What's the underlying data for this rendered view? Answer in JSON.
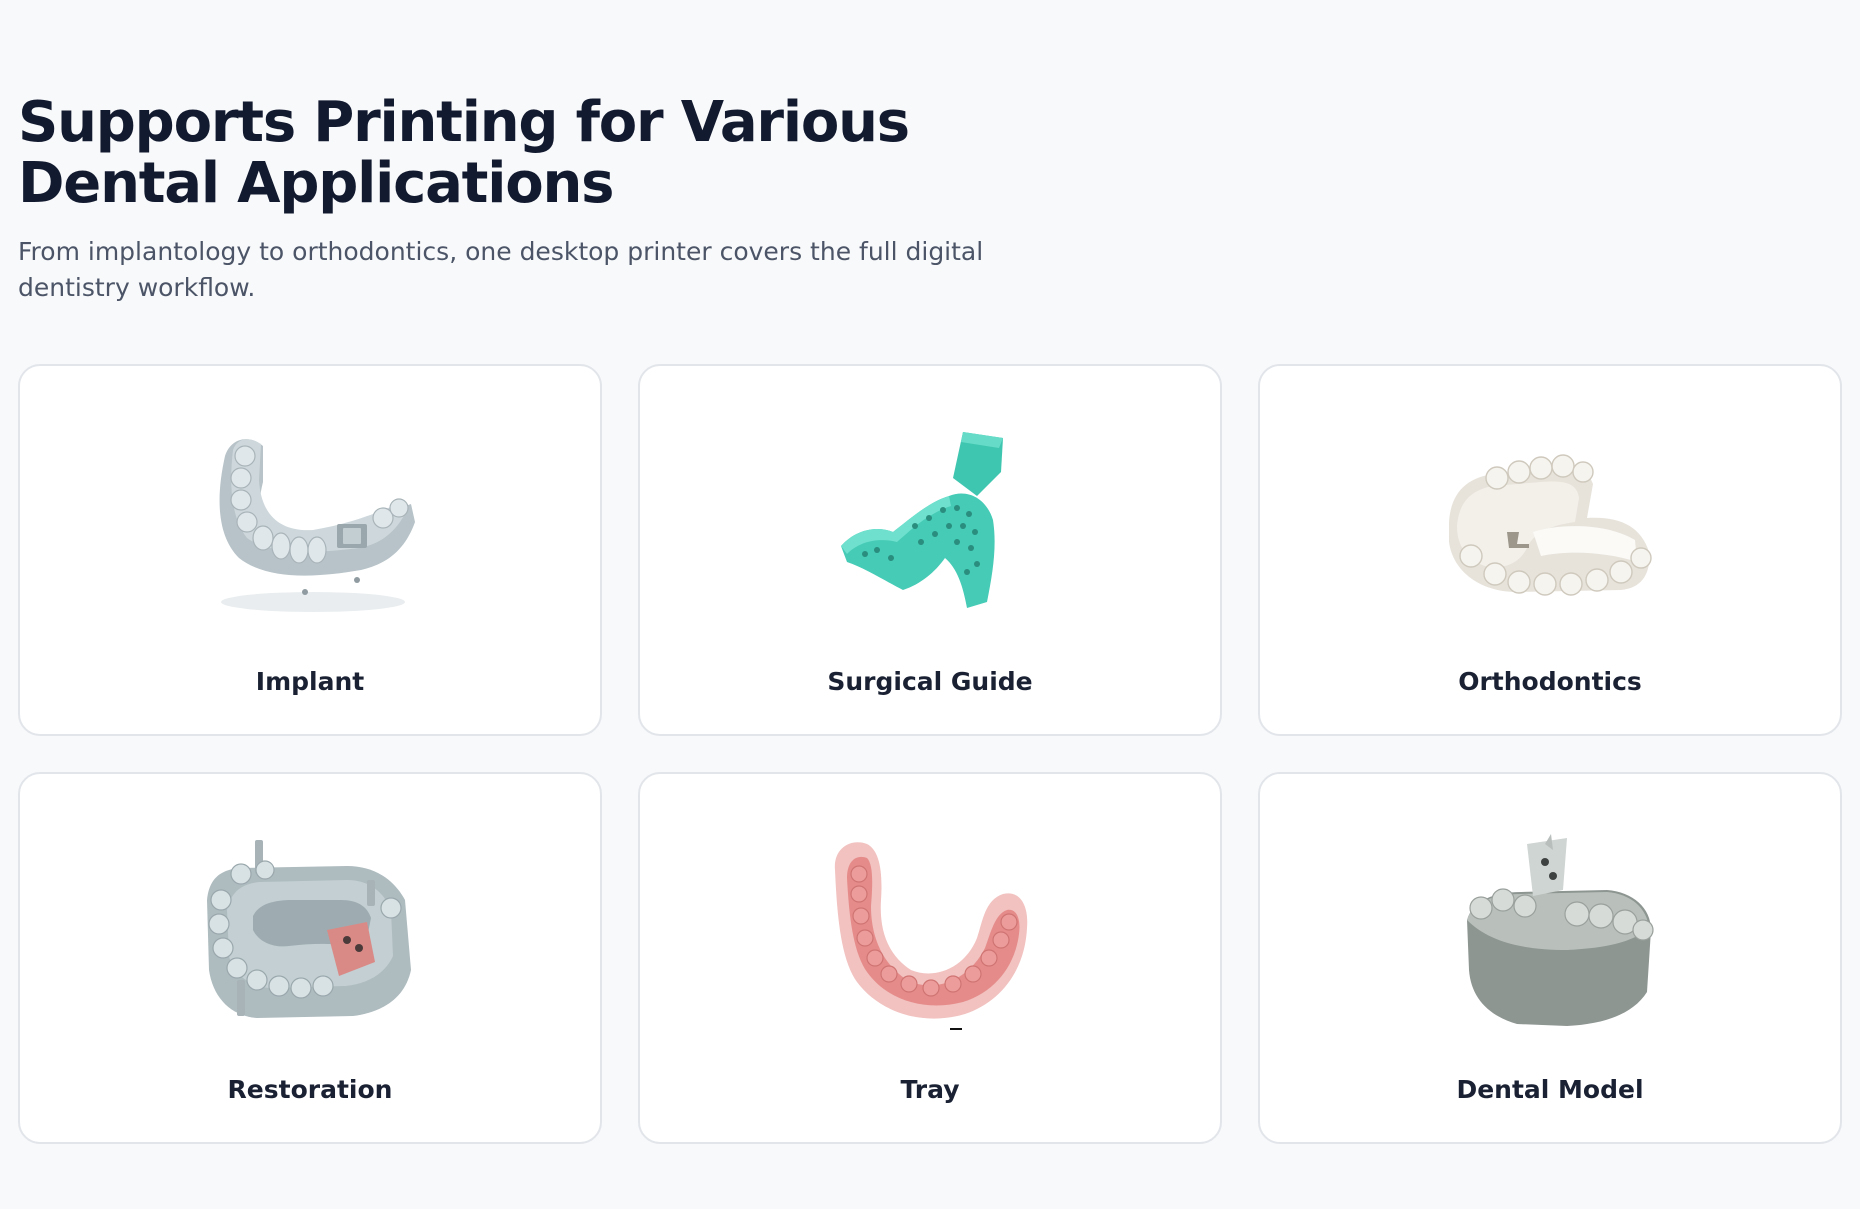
{
  "header": {
    "title": "Supports Printing for Various Dental Applications",
    "subtitle": "From implantology to orthodontics, one desktop printer covers the full digital dentistry workflow."
  },
  "applications": [
    {
      "label": "Implant",
      "image": "implant-model-image",
      "color": "#b9c5ca"
    },
    {
      "label": "Surgical Guide",
      "image": "surgical-guide-image",
      "color": "#43cbb5"
    },
    {
      "label": "Orthodontics",
      "image": "orthodontic-model-image",
      "color": "#ece8e0"
    },
    {
      "label": "Restoration",
      "image": "restoration-model-image",
      "color": "#b3c0c4"
    },
    {
      "label": "Tray",
      "image": "tray-image",
      "color": "#e8a4a1"
    },
    {
      "label": "Dental Model",
      "image": "dental-model-image",
      "color": "#a6ada9"
    }
  ]
}
